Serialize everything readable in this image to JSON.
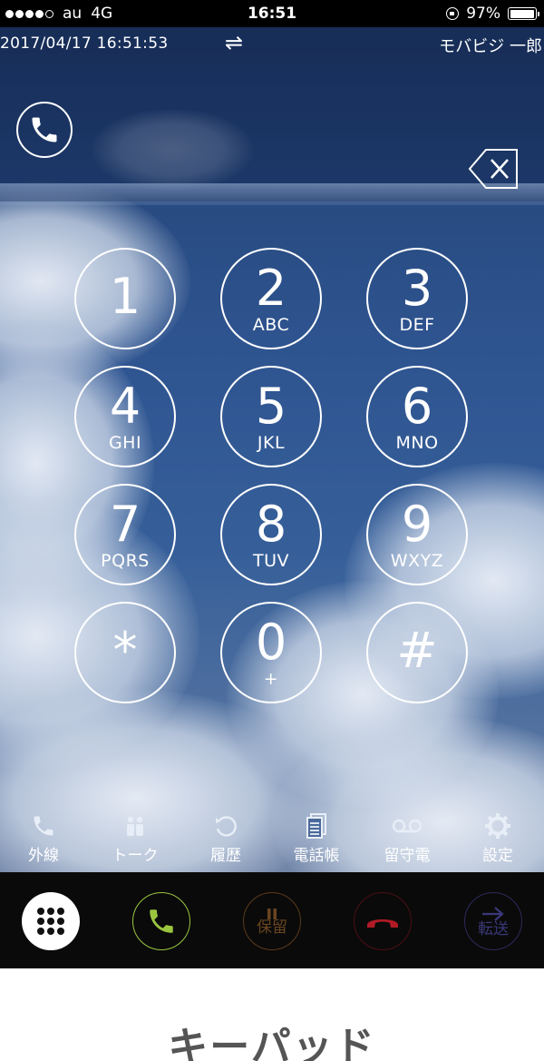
{
  "status_bar": {
    "carrier": "au",
    "network": "4G",
    "time": "16:51",
    "battery_percent": "97%",
    "battery_level": 0.97,
    "signal_bars": 4
  },
  "info_bar": {
    "datetime": "2017/04/17  16:51:53",
    "swap_icon": "⇌",
    "user_name": "モバビジ 一郎"
  },
  "keypad": [
    {
      "digit": "1",
      "letters": ""
    },
    {
      "digit": "2",
      "letters": "ABC"
    },
    {
      "digit": "3",
      "letters": "DEF"
    },
    {
      "digit": "4",
      "letters": "GHI"
    },
    {
      "digit": "5",
      "letters": "JKL"
    },
    {
      "digit": "6",
      "letters": "MNO"
    },
    {
      "digit": "7",
      "letters": "PQRS"
    },
    {
      "digit": "8",
      "letters": "TUV"
    },
    {
      "digit": "9",
      "letters": "WXYZ"
    },
    {
      "digit": "*",
      "letters": ""
    },
    {
      "digit": "0",
      "letters": "+"
    },
    {
      "digit": "#",
      "letters": ""
    }
  ],
  "tabs": [
    {
      "label": "外線",
      "icon": "phone-icon"
    },
    {
      "label": "トーク",
      "icon": "people-icon"
    },
    {
      "label": "履歴",
      "icon": "history-icon"
    },
    {
      "label": "電話帳",
      "icon": "phonebook-icon"
    },
    {
      "label": "留守電",
      "icon": "voicemail-icon"
    },
    {
      "label": "設定",
      "icon": "gear-icon"
    }
  ],
  "call_bar": {
    "hold_label": "保留",
    "transfer_label": "転送"
  },
  "caption": "キーパッド",
  "colors": {
    "call_green": "#9ac53f",
    "end_red": "#b01a25",
    "hold_brown": "#6a4520",
    "transfer_purple": "#3a3878"
  }
}
